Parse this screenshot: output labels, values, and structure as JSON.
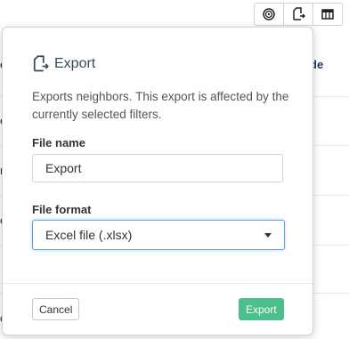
{
  "toolbar": {
    "icons": [
      "target-icon",
      "export-icon",
      "columns-icon"
    ]
  },
  "background": {
    "right_header_fragment": "de",
    "left_header_fragment": "e",
    "left_row_fragments": [
      "e",
      "n",
      "e",
      "e"
    ]
  },
  "modal": {
    "title": "Export",
    "description": "Exports neighbors. This export is affected by the currently selected filters.",
    "file_name_label": "File name",
    "file_name_value": "Export",
    "file_format_label": "File format",
    "file_format_value": "Excel file (.xlsx)",
    "cancel_label": "Cancel",
    "export_label": "Export"
  },
  "colors": {
    "accent_green": "#4bbf8c",
    "focus_blue": "#5aa0e6",
    "title_color": "#34495e"
  }
}
